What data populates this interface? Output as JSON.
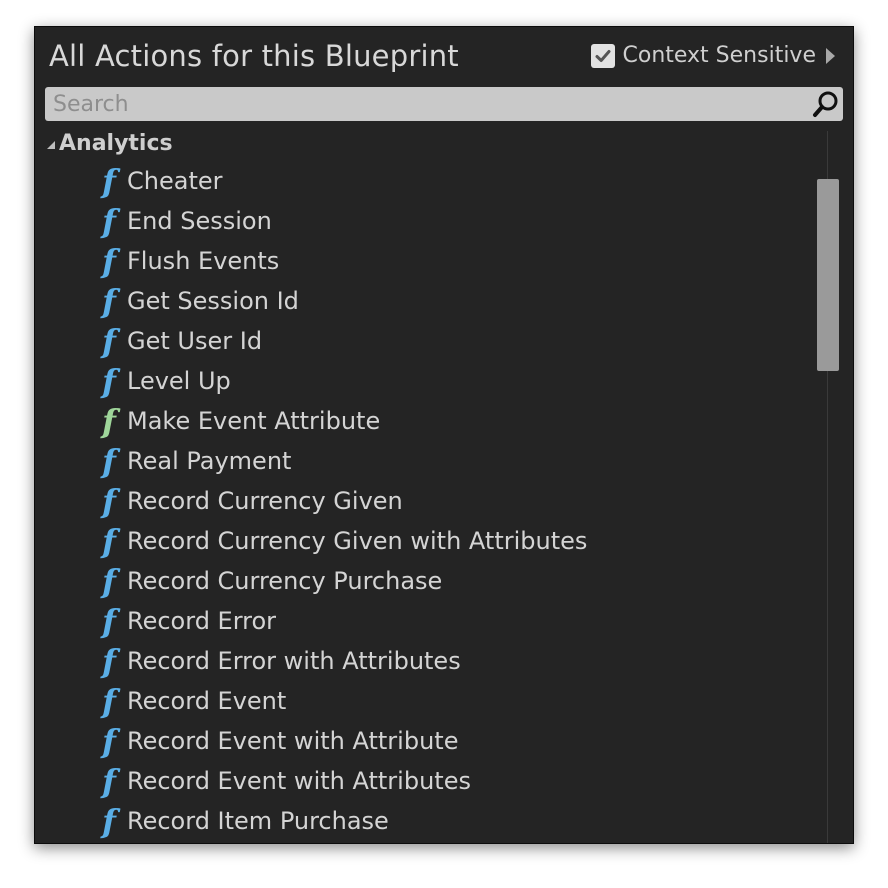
{
  "header": {
    "title": "All Actions for this Blueprint",
    "context_sensitive_label": "Context Sensitive",
    "context_sensitive_checked": true
  },
  "search": {
    "placeholder": "Search",
    "value": ""
  },
  "category": {
    "label": "Analytics",
    "expanded": true
  },
  "items": [
    {
      "label": "Cheater",
      "icon": "function-icon",
      "color": "#5aaee6"
    },
    {
      "label": "End Session",
      "icon": "function-icon",
      "color": "#5aaee6"
    },
    {
      "label": "Flush Events",
      "icon": "function-icon",
      "color": "#5aaee6"
    },
    {
      "label": "Get Session Id",
      "icon": "function-icon",
      "color": "#5aaee6"
    },
    {
      "label": "Get User Id",
      "icon": "function-icon",
      "color": "#5aaee6"
    },
    {
      "label": "Level Up",
      "icon": "function-icon",
      "color": "#5aaee6"
    },
    {
      "label": "Make Event Attribute",
      "icon": "pure-function-icon",
      "color": "#9fd69a"
    },
    {
      "label": "Real Payment",
      "icon": "function-icon",
      "color": "#5aaee6"
    },
    {
      "label": "Record Currency Given",
      "icon": "function-icon",
      "color": "#5aaee6"
    },
    {
      "label": "Record Currency Given with Attributes",
      "icon": "function-icon",
      "color": "#5aaee6"
    },
    {
      "label": "Record Currency Purchase",
      "icon": "function-icon",
      "color": "#5aaee6"
    },
    {
      "label": "Record Error",
      "icon": "function-icon",
      "color": "#5aaee6"
    },
    {
      "label": "Record Error with Attributes",
      "icon": "function-icon",
      "color": "#5aaee6"
    },
    {
      "label": "Record Event",
      "icon": "function-icon",
      "color": "#5aaee6"
    },
    {
      "label": "Record Event with Attribute",
      "icon": "function-icon",
      "color": "#5aaee6"
    },
    {
      "label": "Record Event with Attributes",
      "icon": "function-icon",
      "color": "#5aaee6"
    },
    {
      "label": "Record Item Purchase",
      "icon": "function-icon",
      "color": "#5aaee6"
    }
  ],
  "function_glyph": "f",
  "colors": {
    "panel_bg": "#242424",
    "function_blue": "#5aaee6",
    "pure_function_green": "#9fd69a",
    "search_bg": "#c9c9c9"
  }
}
